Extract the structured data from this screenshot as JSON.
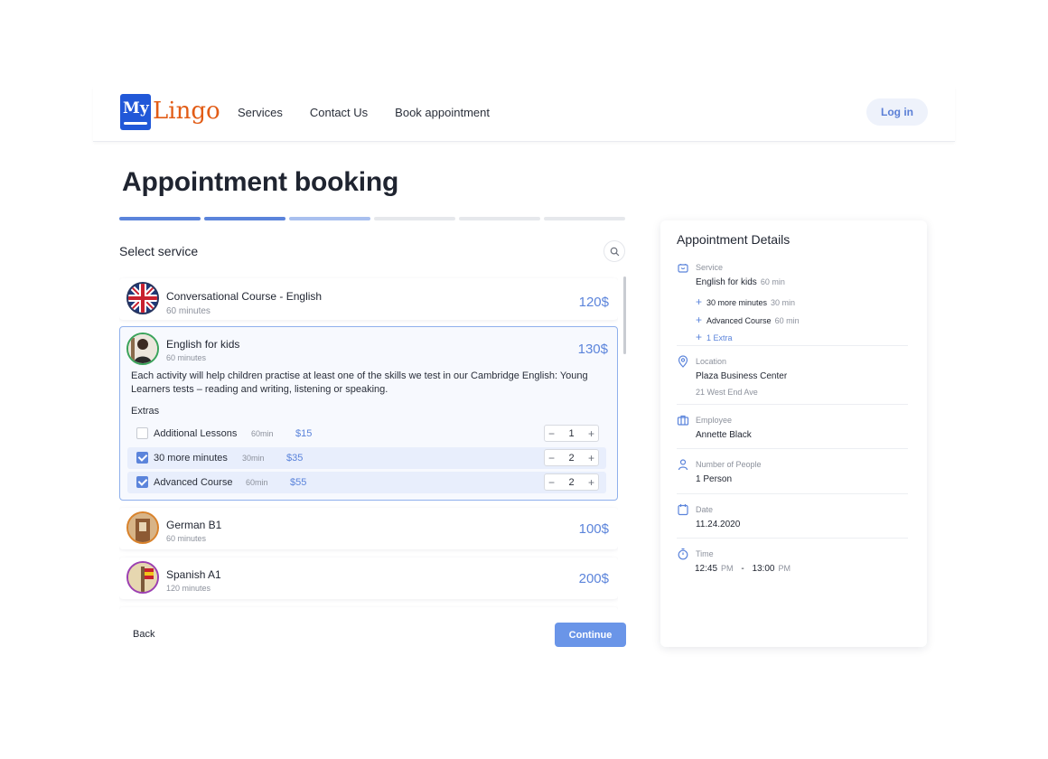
{
  "header": {
    "logo_box": "My",
    "logo_text": "Lingo",
    "nav": [
      "Services",
      "Contact Us",
      "Book appointment"
    ],
    "login_label": "Log in"
  },
  "page": {
    "title": "Appointment booking",
    "progress": {
      "total_steps": 6,
      "completed_steps": 2,
      "current_step": 3
    }
  },
  "services": {
    "label": "Select service",
    "items": [
      {
        "name": "Conversational Course - English",
        "duration": "60 minutes",
        "price": "120$",
        "ring": "#26345f",
        "icon": "uk-flag-icon"
      },
      {
        "name": "English for kids",
        "duration": "60 minutes",
        "price": "130$",
        "ring": "#3aa35a",
        "icon": "kids-photo-icon"
      },
      {
        "name": "German B1",
        "duration": "60 minutes",
        "price": "100$",
        "ring": "#d9822b",
        "icon": "germany-photo-icon"
      },
      {
        "name": "Spanish A1",
        "duration": "120 minutes",
        "price": "200$",
        "ring": "#9b3fb2",
        "icon": "spain-photo-icon"
      }
    ],
    "selected_description": "Each activity will help children practise at least one of the skills we test in our Cambridge English: Young Learners tests – reading and writing, listening or speaking.",
    "extras_label": "Extras",
    "extras": [
      {
        "name": "Additional Lessons",
        "duration": "60min",
        "price": "$15",
        "checked": false,
        "qty": "1"
      },
      {
        "name": "30 more minutes",
        "duration": "30min",
        "price": "$35",
        "checked": true,
        "qty": "2"
      },
      {
        "name": "Advanced Course",
        "duration": "60min",
        "price": "$55",
        "checked": true,
        "qty": "2"
      }
    ]
  },
  "footer": {
    "back": "Back",
    "continue": "Continue"
  },
  "details": {
    "title": "Appointment Details",
    "service": {
      "label": "Service",
      "name": "English for kids",
      "duration": "60 min",
      "extras": [
        {
          "name": "30 more minutes",
          "duration": "30 min"
        },
        {
          "name": "Advanced Course",
          "duration": "60 min"
        }
      ],
      "more_extras": "1 Extra"
    },
    "location": {
      "label": "Location",
      "name": "Plaza Business Center",
      "address": "21 West End Ave"
    },
    "employee": {
      "label": "Employee",
      "name": "Annette Black"
    },
    "people": {
      "label": "Number of People",
      "value": "1 Person"
    },
    "date": {
      "label": "Date",
      "value": "11.24.2020"
    },
    "time": {
      "label": "Time",
      "start": "12:45",
      "start_suffix": "PM",
      "separator": "-",
      "end": "13:00",
      "end_suffix": "PM"
    }
  },
  "colors": {
    "accent": "#5b84db",
    "brand_blue": "#2158d8",
    "brand_orange": "#e25c16"
  }
}
